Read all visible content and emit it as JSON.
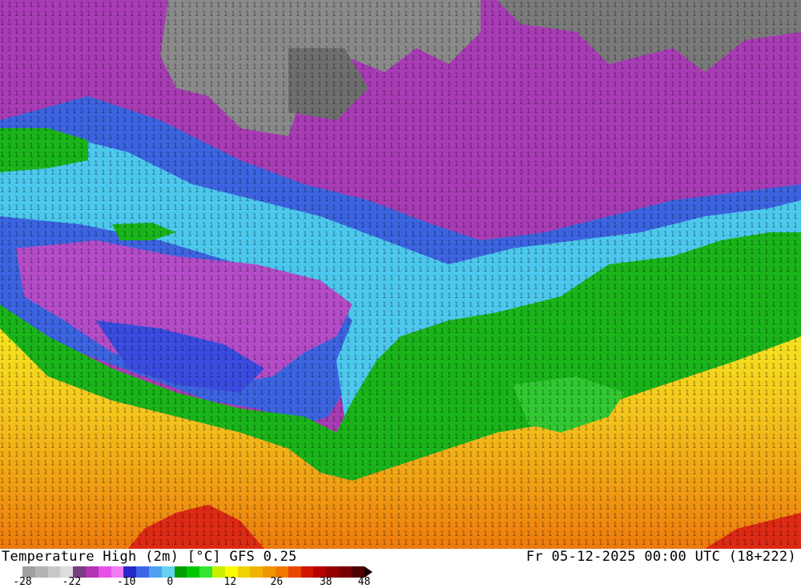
{
  "title": {
    "left": "Temperature High (2m) [°C] GFS 0.25",
    "right": "Fr 05-12-2025 00:00 UTC (18+222)"
  },
  "legend": {
    "ticks": [
      "-28",
      "-22",
      "-10",
      "0",
      "12",
      "26",
      "38",
      "48"
    ],
    "colors": [
      "#a0a0a0",
      "#b4b4b4",
      "#c8c8c8",
      "#dcdcdc",
      "#7a3c82",
      "#b432b4",
      "#e650e6",
      "#f07cf0",
      "#2828c8",
      "#3c64e6",
      "#50a0f0",
      "#64d2f0",
      "#00a000",
      "#00c800",
      "#32e632",
      "#c8f000",
      "#fafa00",
      "#f0d200",
      "#f0b400",
      "#f09600",
      "#f07800",
      "#e64600",
      "#d21400",
      "#b40000",
      "#960000",
      "#780000",
      "#500000"
    ],
    "accent_low": "#ffffff",
    "accent_high": "#1a0000"
  },
  "map": {
    "description_colors": {
      "cold_gray": "#8c8c8c",
      "violet": "#9a30a8",
      "magenta": "#c84cd2",
      "blue": "#3a64e0",
      "cyan": "#3cc8f0",
      "green": "#18b418",
      "yellow": "#f0e628",
      "orange": "#f09a14",
      "red": "#dc2814"
    }
  }
}
